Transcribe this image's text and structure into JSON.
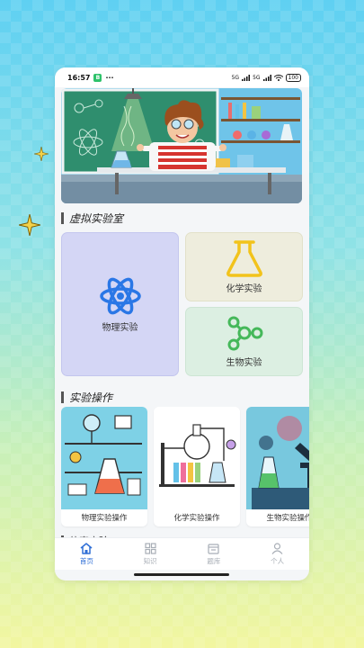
{
  "status": {
    "time": "16:57",
    "app_badge": "B",
    "more": "···",
    "signal1": "5G",
    "signal2": "5G",
    "battery": "100"
  },
  "banner": {
    "image": "scientist-lab-illustration"
  },
  "sections": {
    "virtual_lab": {
      "title": "虚拟实验室"
    },
    "operations": {
      "title": "实验操作"
    },
    "next": {
      "title": "仿真实验"
    }
  },
  "lab_cards": {
    "physics": {
      "label": "物理实验",
      "icon": "atom-icon",
      "bg": "#d4d6f5"
    },
    "chemistry": {
      "label": "化学实验",
      "icon": "flask-icon",
      "bg": "#eeeddd"
    },
    "biology": {
      "label": "生物实验",
      "icon": "molecule-icon",
      "bg": "#dcefe2"
    }
  },
  "operations": [
    {
      "label": "物理实验操作"
    },
    {
      "label": "化学实验操作"
    },
    {
      "label": "生物实验操作"
    }
  ],
  "tabs": [
    {
      "label": "首页",
      "icon": "home-icon",
      "active": true
    },
    {
      "label": "知识",
      "icon": "grid-icon",
      "active": false
    },
    {
      "label": "题库",
      "icon": "library-icon",
      "active": false
    },
    {
      "label": "个人",
      "icon": "user-icon",
      "active": false
    }
  ],
  "colors": {
    "accent": "#2f6fd6",
    "atom": "#2a77e6",
    "flask": "#f2c31b",
    "molecule": "#45b85a"
  }
}
